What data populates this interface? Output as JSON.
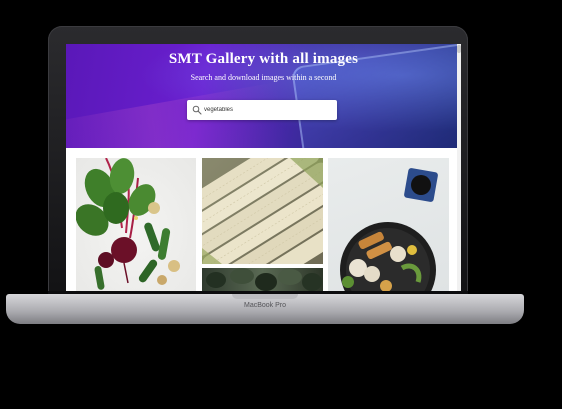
{
  "hero": {
    "title": "SMT Gallery with all images",
    "subtitle": "Search and download images within a second"
  },
  "search": {
    "value": "vegetables"
  },
  "gallery": {
    "images": [
      {
        "name": "beetroot-and-cucumbers-photo"
      },
      {
        "name": "white-corn-cobs-photo"
      },
      {
        "name": "dark-greens-photo"
      },
      {
        "name": "vegetable-bowl-with-sauce-photo"
      }
    ]
  },
  "device": {
    "model_label": "MacBook Pro"
  },
  "colors": {
    "hero_purple": "#6a1fd0",
    "hero_blue": "#1e2a78"
  }
}
